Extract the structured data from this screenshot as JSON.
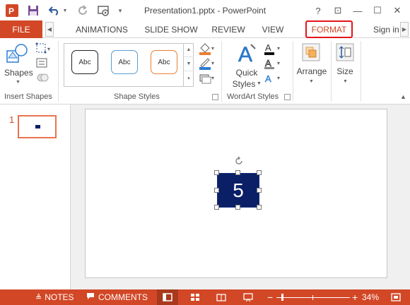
{
  "window": {
    "title": "Presentation1.pptx - PowerPoint",
    "help_glyph": "?",
    "restore_glyph": "⊡",
    "minimize_glyph": "—",
    "maximize_glyph": "☐",
    "close_glyph": "✕"
  },
  "tabs": {
    "file": "FILE",
    "items": [
      "ANIMATIONS",
      "SLIDE SHOW",
      "REVIEW",
      "VIEW",
      "FORMAT"
    ],
    "active": "FORMAT",
    "sign_in": "Sign in"
  },
  "ribbon": {
    "insert_shapes": {
      "label": "Insert Shapes",
      "shapes_button": "Shapes"
    },
    "shape_styles": {
      "label": "Shape Styles",
      "thumbs": [
        "Abc",
        "Abc",
        "Abc"
      ]
    },
    "wordart_styles": {
      "label": "WordArt Styles",
      "quick_styles_line1": "Quick",
      "quick_styles_line2": "Styles"
    },
    "arrange": {
      "label": "Arrange"
    },
    "size": {
      "label": "Size"
    }
  },
  "slides": {
    "current_number": "1",
    "shape_text": "5"
  },
  "statusbar": {
    "notes": "NOTES",
    "comments": "COMMENTS",
    "zoom": "34%"
  },
  "colors": {
    "accent": "#d24726",
    "format_highlight": "#e3141b",
    "shape_fill": "#0b1f66"
  }
}
